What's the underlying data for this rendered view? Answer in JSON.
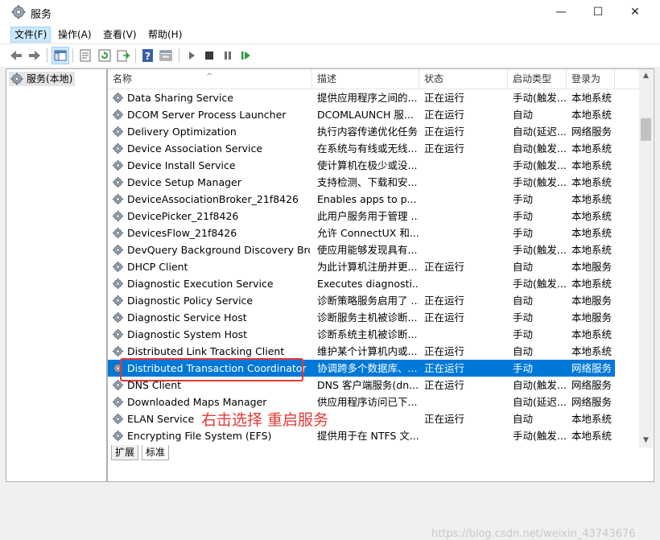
{
  "window": {
    "title": "服务"
  },
  "titlebar": {
    "minimize": "—",
    "maximize": "☐",
    "close": "✕"
  },
  "menubar": {
    "items": [
      {
        "label": "文件(F)"
      },
      {
        "label": "操作(A)"
      },
      {
        "label": "查看(V)"
      },
      {
        "label": "帮助(H)"
      }
    ]
  },
  "toolbar": {
    "icons": [
      "back-icon",
      "forward-icon",
      "console-tree-icon",
      "properties-icon",
      "refresh-icon",
      "export-icon",
      "help-icon",
      "view-icon",
      "start-icon",
      "stop-icon",
      "pause-icon",
      "restart-icon"
    ]
  },
  "tree": {
    "root_label": "服务(本地)"
  },
  "table": {
    "headers": {
      "name": "名称",
      "desc": "描述",
      "state": "状态",
      "start": "启动类型",
      "logon": "登录为"
    },
    "rows": [
      {
        "name": "Data Sharing Service",
        "desc": "提供应用程序之间的...",
        "state": "正在运行",
        "start": "手动(触发...",
        "logon": "本地系统"
      },
      {
        "name": "DCOM Server Process Launcher",
        "desc": "DCOMLAUNCH 服...",
        "state": "正在运行",
        "start": "自动",
        "logon": "本地系统"
      },
      {
        "name": "Delivery Optimization",
        "desc": "执行内容传递优化任务",
        "state": "正在运行",
        "start": "自动(延迟...",
        "logon": "网络服务"
      },
      {
        "name": "Device Association Service",
        "desc": "在系统与有线或无线...",
        "state": "正在运行",
        "start": "自动(触发...",
        "logon": "本地系统"
      },
      {
        "name": "Device Install Service",
        "desc": "使计算机在极少或没...",
        "state": "",
        "start": "手动(触发...",
        "logon": "本地系统"
      },
      {
        "name": "Device Setup Manager",
        "desc": "支持检测、下载和安...",
        "state": "",
        "start": "手动(触发...",
        "logon": "本地系统"
      },
      {
        "name": "DeviceAssociationBroker_21f8426",
        "desc": "Enables apps to p...",
        "state": "",
        "start": "手动",
        "logon": "本地系统"
      },
      {
        "name": "DevicePicker_21f8426",
        "desc": "此用户服务用于管理 ...",
        "state": "",
        "start": "手动",
        "logon": "本地系统"
      },
      {
        "name": "DevicesFlow_21f8426",
        "desc": "允许 ConnectUX 和...",
        "state": "",
        "start": "手动",
        "logon": "本地系统"
      },
      {
        "name": "DevQuery Background Discovery Bro...",
        "desc": "使应用能够发现具有...",
        "state": "",
        "start": "手动(触发...",
        "logon": "本地系统"
      },
      {
        "name": "DHCP Client",
        "desc": "为此计算机注册并更...",
        "state": "正在运行",
        "start": "自动",
        "logon": "本地服务"
      },
      {
        "name": "Diagnostic Execution Service",
        "desc": "Executes diagnosti...",
        "state": "",
        "start": "手动(触发...",
        "logon": "本地系统"
      },
      {
        "name": "Diagnostic Policy Service",
        "desc": "诊断策略服务启用了 ...",
        "state": "正在运行",
        "start": "自动",
        "logon": "本地服务"
      },
      {
        "name": "Diagnostic Service Host",
        "desc": "诊断服务主机被诊断...",
        "state": "正在运行",
        "start": "手动",
        "logon": "本地服务"
      },
      {
        "name": "Diagnostic System Host",
        "desc": "诊断系统主机被诊断...",
        "state": "",
        "start": "手动",
        "logon": "本地系统"
      },
      {
        "name": "Distributed Link Tracking Client",
        "desc": "维护某个计算机内或...",
        "state": "正在运行",
        "start": "自动",
        "logon": "本地系统"
      },
      {
        "name": "Distributed Transaction Coordinator",
        "desc": "协调跨多个数据库、...",
        "state": "正在运行",
        "start": "手动",
        "logon": "网络服务"
      },
      {
        "name": "DNS Client",
        "desc": "DNS 客户端服务(dn...",
        "state": "正在运行",
        "start": "自动(触发...",
        "logon": "网络服务"
      },
      {
        "name": "Downloaded Maps Manager",
        "desc": "供应用程序访问已下...",
        "state": "",
        "start": "自动(延迟...",
        "logon": "网络服务"
      },
      {
        "name": "ELAN Service",
        "desc": "",
        "state": "正在运行",
        "start": "自动",
        "logon": "本地系统"
      },
      {
        "name": "Encrypting File System (EFS)",
        "desc": "提供用于在 NTFS 文...",
        "state": "",
        "start": "手动(触发...",
        "logon": "本地系统"
      }
    ]
  },
  "tabs": {
    "extended": "扩展",
    "standard": "标准"
  },
  "annotation": {
    "text": "右击选择  重启服务"
  },
  "watermark": {
    "text": "https://blog.csdn.net/weixin_43743676"
  },
  "colors": {
    "selection": "#0078d7",
    "annotation": "#e53935"
  }
}
